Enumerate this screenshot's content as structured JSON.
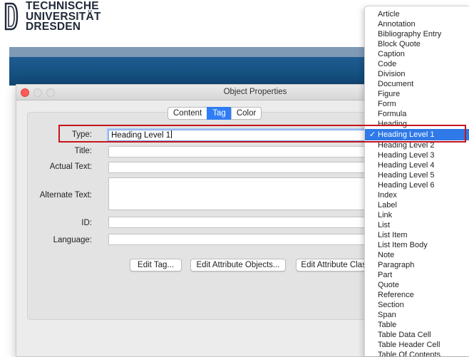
{
  "logo": {
    "lines": [
      "TECHNISCHE",
      "UNIVERSITÄT",
      "DRESDEN"
    ]
  },
  "dialog": {
    "title": "Object Properties",
    "tabs": [
      {
        "label": "Content",
        "active": false
      },
      {
        "label": "Tag",
        "active": true
      },
      {
        "label": "Color",
        "active": false
      }
    ],
    "fields": {
      "type": {
        "label": "Type:",
        "value": "Heading Level 1"
      },
      "title": {
        "label": "Title:",
        "value": ""
      },
      "actual_text": {
        "label": "Actual Text:",
        "value": ""
      },
      "alternate_text": {
        "label": "Alternate Text:",
        "value": ""
      },
      "id": {
        "label": "ID:",
        "value": ""
      },
      "language": {
        "label": "Language:",
        "value": ""
      }
    },
    "buttons": {
      "edit_tag": "Edit Tag...",
      "edit_attribute_objects": "Edit Attribute Objects...",
      "edit_attribute_classes": "Edit Attribute Class"
    }
  },
  "dropdown": {
    "selected": "Heading Level 1",
    "items": [
      "Article",
      "Annotation",
      "Bibliography Entry",
      "Block Quote",
      "Caption",
      "Code",
      "Division",
      "Document",
      "Figure",
      "Form",
      "Formula",
      "Heading",
      "Heading Level 1",
      "Heading Level 2",
      "Heading Level 3",
      "Heading Level 4",
      "Heading Level 5",
      "Heading Level 6",
      "Index",
      "Label",
      "Link",
      "List",
      "List Item",
      "List Item Body",
      "Note",
      "Paragraph",
      "Part",
      "Quote",
      "Reference",
      "Section",
      "Span",
      "Table",
      "Table Data Cell",
      "Table Header Cell",
      "Table Of Contents"
    ]
  },
  "colors": {
    "accent": "#2f79e8",
    "highlight_border": "#c4161c",
    "banner": "#14507f"
  }
}
